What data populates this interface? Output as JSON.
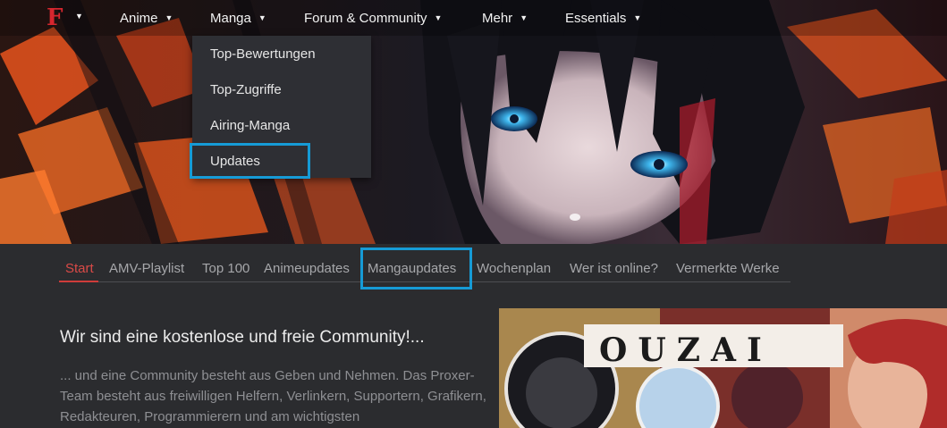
{
  "nav": {
    "logo_letter": "F",
    "items": [
      {
        "label": "Anime"
      },
      {
        "label": "Manga"
      },
      {
        "label": "Forum & Community"
      },
      {
        "label": "Mehr"
      },
      {
        "label": "Essentials"
      }
    ],
    "caret": "▼"
  },
  "dropdown": {
    "items": [
      {
        "label": "Top-Bewertungen"
      },
      {
        "label": "Top-Zugriffe"
      },
      {
        "label": "Airing-Manga"
      },
      {
        "label": "Updates"
      }
    ],
    "highlighted": "Updates"
  },
  "subnav": {
    "active": "Start",
    "items": [
      {
        "label": "Start"
      },
      {
        "label": "AMV-Playlist"
      },
      {
        "label": "Top 100"
      },
      {
        "label": "Animeupdates"
      },
      {
        "label": "Mangaupdates"
      },
      {
        "label": "Wochenplan"
      },
      {
        "label": "Wer ist online?"
      },
      {
        "label": "Vermerkte Werke"
      }
    ],
    "highlighted": "Mangaupdates"
  },
  "main": {
    "title": "Wir sind eine kostenlose und freie Community!...",
    "text": "... und eine Community besteht aus Geben und Nehmen. Das Proxer-Team besteht aus freiwilligen Helfern, Verlinkern, Supportern, Grafikern, Redakteuren, Programmierern und am wichtigsten"
  },
  "promo": {
    "title": "OUZAI"
  },
  "colors": {
    "background": "#2b2c2f",
    "accent_red": "#d94a47",
    "highlight_blue": "#169bd6",
    "dropdown_bg": "#2e2f34"
  }
}
